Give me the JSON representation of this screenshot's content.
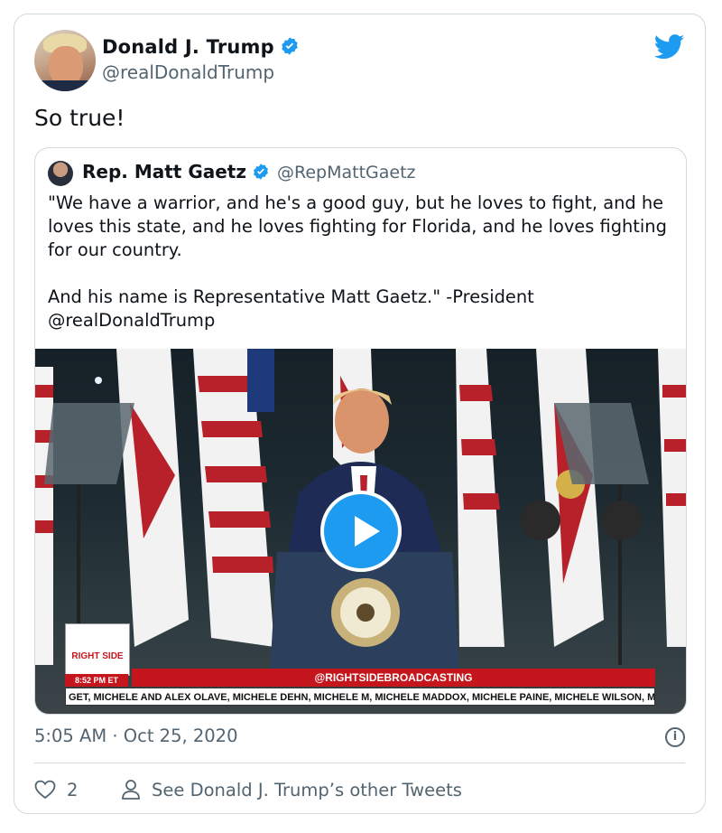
{
  "tweet": {
    "author_name": "Donald J. Trump",
    "author_handle": "@realDonaldTrump",
    "text": "So true!",
    "timestamp": "5:05 AM · Oct 25, 2020",
    "like_count": "2",
    "see_others_label": "See Donald J. Trump’s other Tweets"
  },
  "quote": {
    "author_name": "Rep. Matt Gaetz",
    "author_handle": "@RepMattGaetz",
    "text_line1": "\"We have a warrior, and he's a good guy, but he loves to fight, and he loves this state, and he loves fighting for Florida, and he loves fighting for our country.",
    "text_line2": "And his name is Representative Matt Gaetz.\" -President @realDonaldTrump"
  },
  "video": {
    "logo_text": "RIGHT SIDE",
    "time_badge": "8:52 PM ET",
    "banner": "@RIGHTSIDEBROADCASTING",
    "ticker": "GET, MICHELE AND ALEX OLAVE, MICHELE DEHN, MICHELE M, MICHELE MADDOX, MICHELE PAINE, MICHELE WILSON, MI"
  },
  "colors": {
    "accent": "#1d9bf0",
    "secondary_text": "#536471",
    "border": "#cfd9de",
    "news_red": "#c4161c"
  },
  "icons": {
    "verified": "verified-badge-icon",
    "brand": "twitter-bird-icon",
    "like": "heart-icon",
    "profile": "person-icon",
    "info": "info-icon",
    "play": "play-icon"
  }
}
